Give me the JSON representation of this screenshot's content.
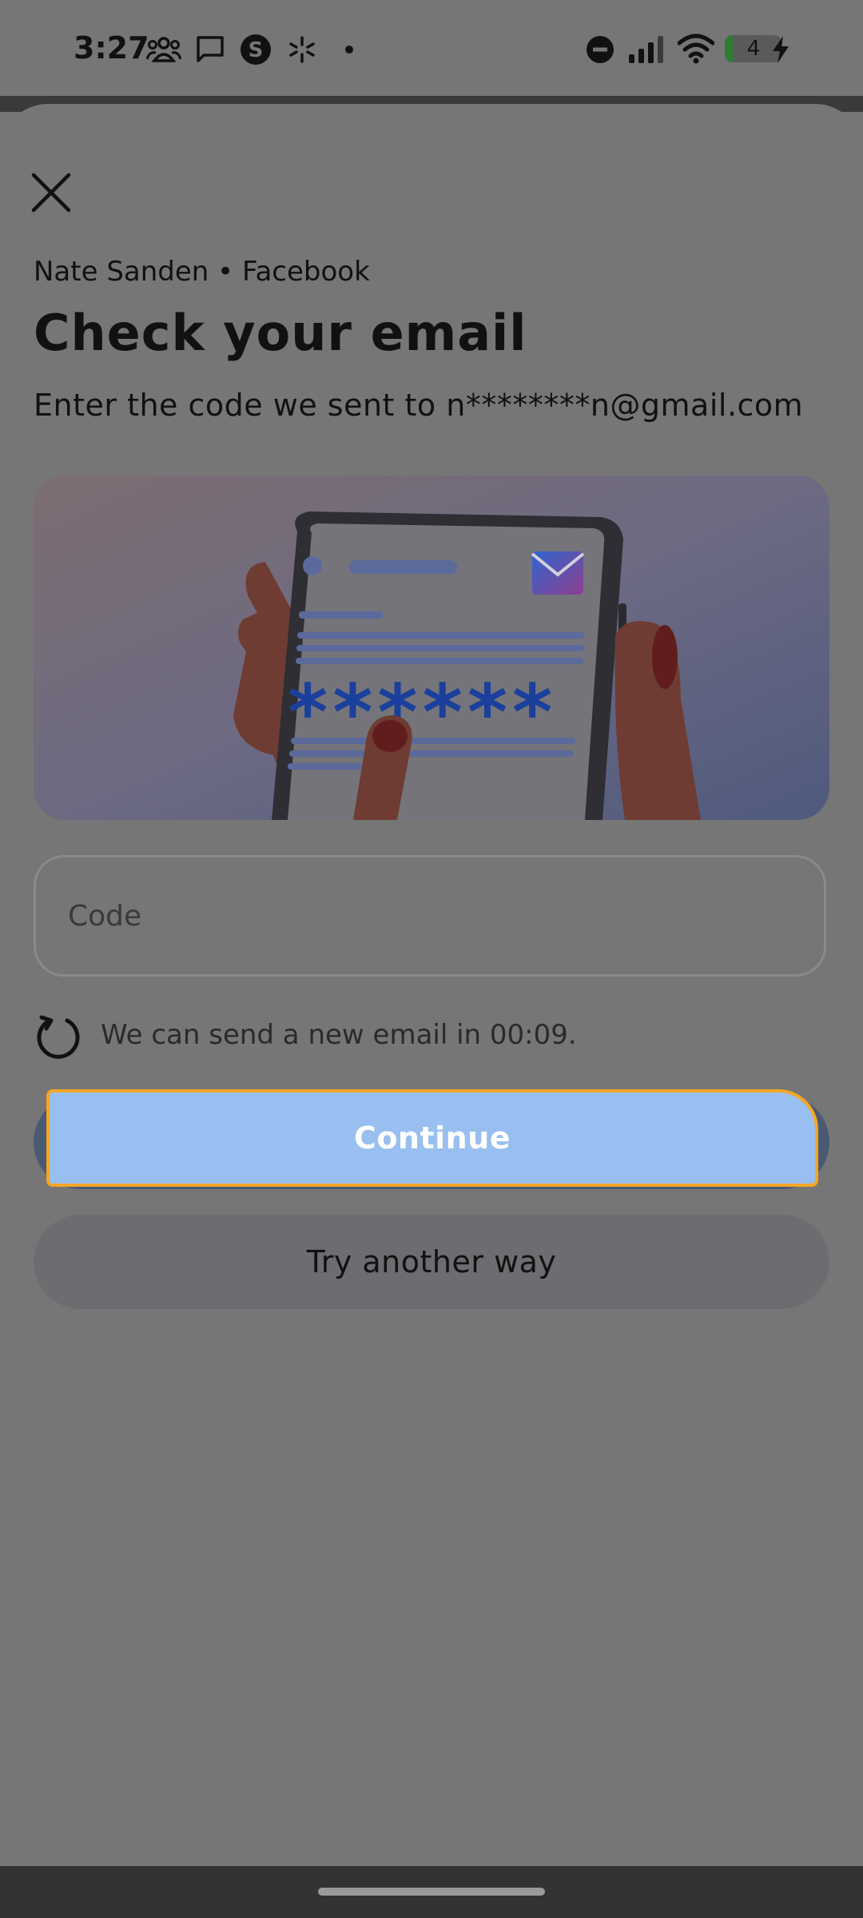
{
  "status_bar": {
    "time": "3:27",
    "notification_icons": [
      "people-icon",
      "chat-icon",
      "dollar-icon",
      "asterisk-icon",
      "dot-icon"
    ],
    "right_icons": [
      "do-not-disturb-icon",
      "signal-icon",
      "wifi-icon",
      "battery-icon",
      "charging-icon"
    ],
    "battery_level": "4"
  },
  "sheet": {
    "account": "Nate Sanden • Facebook",
    "title": "Check your email",
    "subtitle": "Enter the code we sent to n********n@gmail.com",
    "illustration_code": "******",
    "code_input": {
      "placeholder": "Code",
      "value": ""
    },
    "resend_text": "We can send a new email in 00:09.",
    "continue_label": "Continue",
    "try_another_label": "Try another way"
  },
  "colors": {
    "overlay": "#767676",
    "continue_button": "#98bff0",
    "focus_border": "#f5a623",
    "secondary_button": "#6c6d70"
  }
}
